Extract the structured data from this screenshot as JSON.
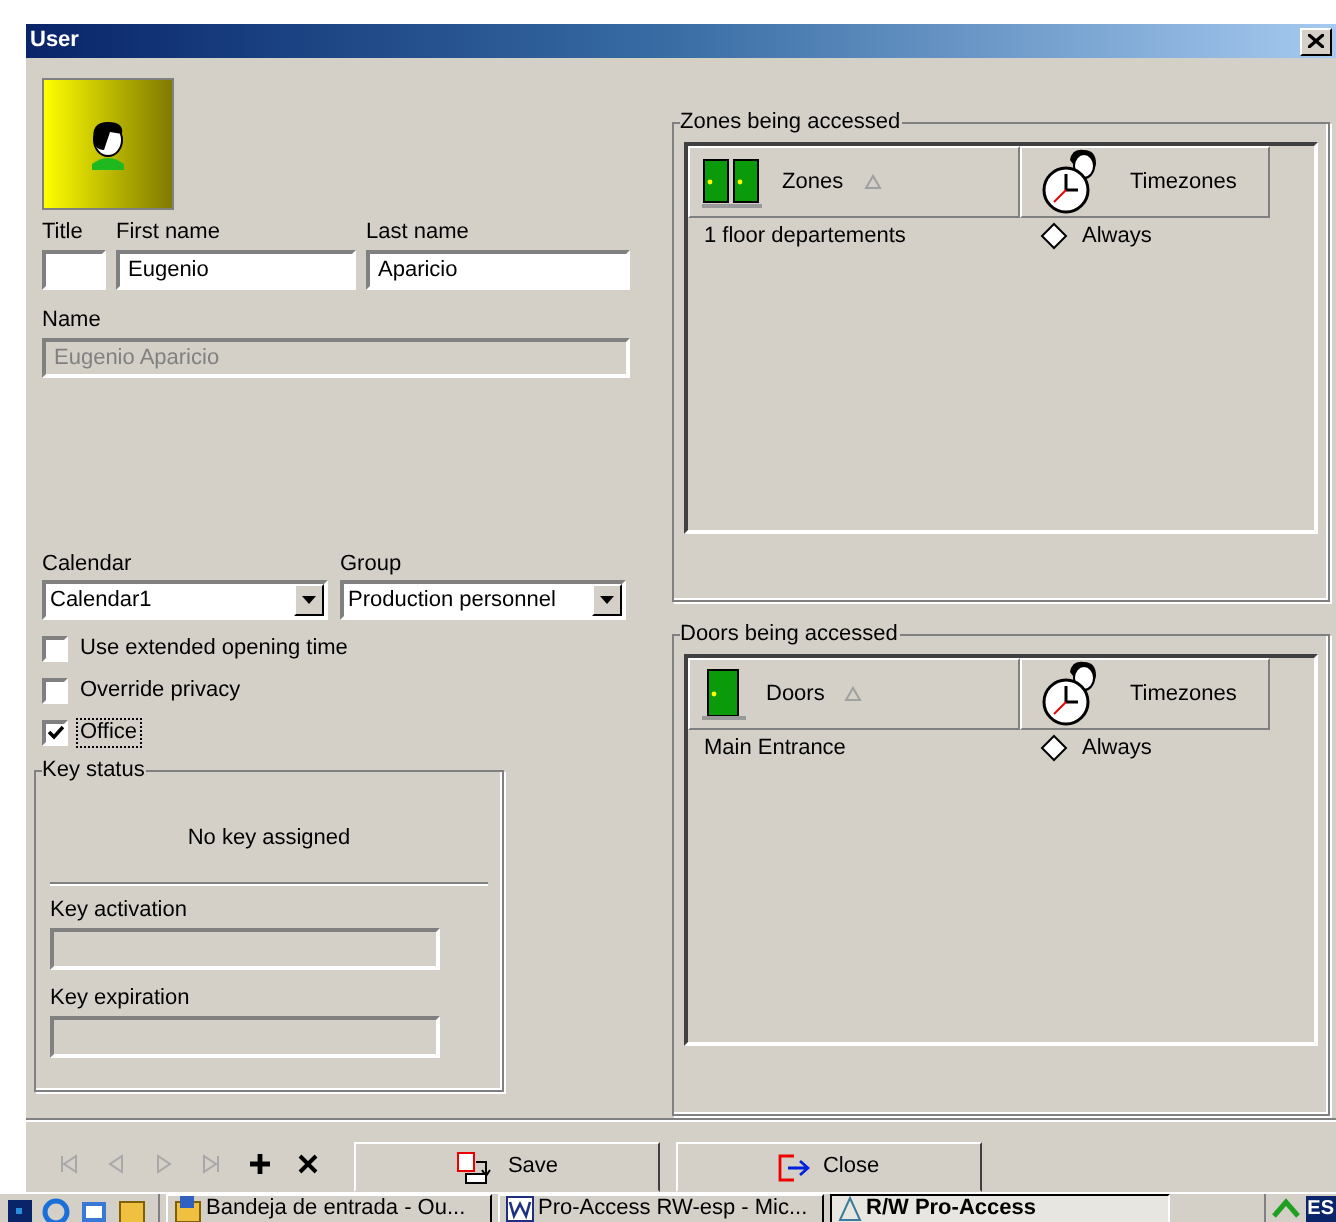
{
  "window": {
    "title": "User"
  },
  "person": {
    "title": {
      "label": "Title"
    },
    "first_name": {
      "label": "First name",
      "value": "Eugenio"
    },
    "last_name": {
      "label": "Last name",
      "value": "Aparicio"
    },
    "name": {
      "label": "Name",
      "value": "Eugenio Aparicio",
      "disabled": true
    }
  },
  "calendar": {
    "label": "Calendar",
    "value": "Calendar1"
  },
  "group": {
    "label": "Group",
    "value": "Production personnel"
  },
  "checkboxes": [
    {
      "label": "Use extended opening time",
      "checked": false,
      "focused": false
    },
    {
      "label": "Override privacy",
      "checked": false,
      "focused": false
    },
    {
      "label": "Office",
      "checked": true,
      "focused": true
    }
  ],
  "key_status": {
    "legend": "Key status",
    "message": "No key assigned",
    "fields": [
      {
        "label": "Key activation"
      },
      {
        "label": "Key expiration"
      }
    ]
  },
  "zones": {
    "legend": "Zones being accessed",
    "columns": [
      {
        "label": "Zones",
        "sorted": true,
        "kind": "zones"
      },
      {
        "label": "Timezones",
        "sorted": false,
        "kind": "timezones"
      }
    ],
    "rows": [
      {
        "name": "1 floor departements",
        "timezone": "Always"
      }
    ]
  },
  "doors": {
    "legend": "Doors being accessed",
    "columns": [
      {
        "label": "Doors",
        "sorted": true,
        "kind": "doors"
      },
      {
        "label": "Timezones",
        "sorted": false,
        "kind": "timezones"
      }
    ],
    "rows": [
      {
        "name": "Main Entrance",
        "timezone": "Always"
      }
    ]
  },
  "toolbar": {
    "navigation_disabled": true,
    "buttons": [
      {
        "kind": "save",
        "label": "Save"
      },
      {
        "kind": "close",
        "label": "Close"
      }
    ]
  },
  "taskbar": {
    "items": [
      {
        "label": "Bandeja de entrada - Ou...",
        "selected": false,
        "kind": "mail"
      },
      {
        "label": "Pro-Access RW-esp - Mic...",
        "selected": false,
        "kind": "word"
      },
      {
        "label": "R/W Pro-Access",
        "selected": true,
        "kind": "app"
      }
    ],
    "tray": {
      "language": "ES"
    }
  }
}
